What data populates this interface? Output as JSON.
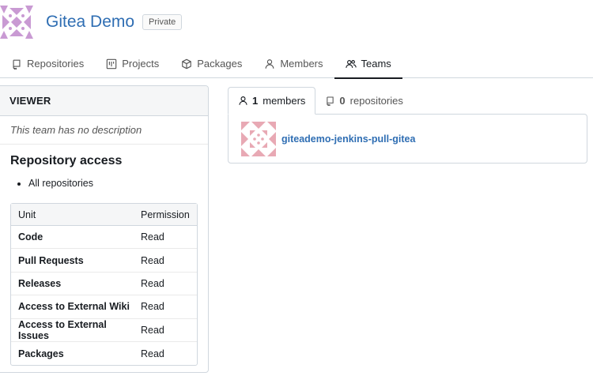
{
  "org": {
    "name": "Gitea Demo",
    "visibility_badge": "Private"
  },
  "tabs": [
    {
      "label": "Repositories",
      "icon": "repo-icon"
    },
    {
      "label": "Projects",
      "icon": "project-icon"
    },
    {
      "label": "Packages",
      "icon": "package-icon"
    },
    {
      "label": "Members",
      "icon": "person-icon"
    },
    {
      "label": "Teams",
      "icon": "people-icon",
      "active": true
    }
  ],
  "team": {
    "name": "VIEWER",
    "description": "This team has no description",
    "repo_access_title": "Repository access",
    "repo_access_items": [
      "All repositories"
    ],
    "table": {
      "headers": {
        "unit": "Unit",
        "permission": "Permission"
      },
      "rows": [
        {
          "unit": "Code",
          "permission": "Read"
        },
        {
          "unit": "Pull Requests",
          "permission": "Read"
        },
        {
          "unit": "Releases",
          "permission": "Read"
        },
        {
          "unit": "Access to External Wiki",
          "permission": "Read"
        },
        {
          "unit": "Access to External Issues",
          "permission": "Read"
        },
        {
          "unit": "Packages",
          "permission": "Read"
        }
      ]
    }
  },
  "member_tabs": {
    "members": {
      "count": "1",
      "label": "members"
    },
    "repositories": {
      "count": "0",
      "label": "repositories"
    }
  },
  "members": [
    {
      "username": "giteademo-jenkins-pull-gitea"
    }
  ],
  "colors": {
    "link": "#2f6eb3",
    "org_avatar": "#c99ad3",
    "member_avatar": "#e8a9b4",
    "border": "#d0d7de"
  }
}
